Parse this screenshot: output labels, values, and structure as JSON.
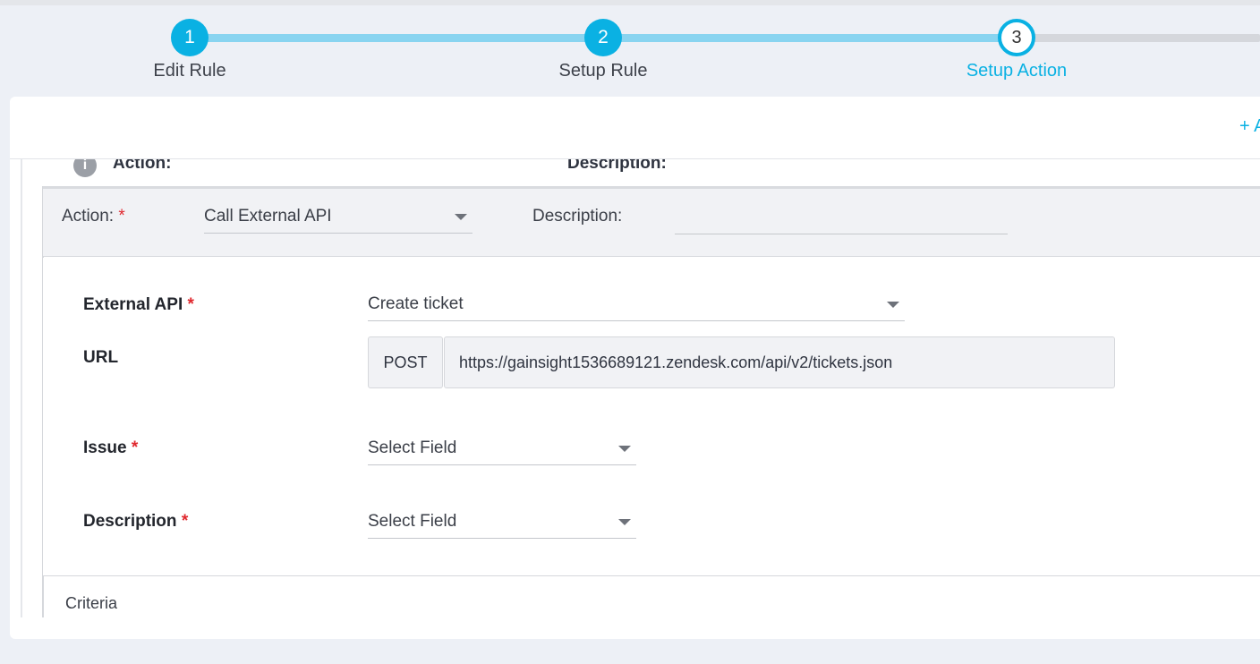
{
  "stepper": {
    "steps": [
      {
        "number": "1",
        "label": "Edit Rule",
        "state": "done"
      },
      {
        "number": "2",
        "label": "Setup Rule",
        "state": "done"
      },
      {
        "number": "3",
        "label": "Setup Action",
        "state": "active"
      }
    ]
  },
  "panel": {
    "add_link": "+ A"
  },
  "collapsed_action": {
    "action_label": "Action:",
    "description_label": "Description:"
  },
  "action_card": {
    "action_label": "Action:",
    "required_mark": "*",
    "action_value": "Call External API",
    "description_label": "Description:",
    "description_value": ""
  },
  "form": {
    "external_api": {
      "label": "External API",
      "required": "*",
      "value": "Create ticket"
    },
    "url": {
      "label": "URL",
      "method": "POST",
      "value": "https://gainsight1536689121.zendesk.com/api/v2/tickets.json"
    },
    "issue": {
      "label": "Issue",
      "required": "*",
      "value": "Select Field"
    },
    "description": {
      "label": "Description",
      "required": "*",
      "value": "Select Field"
    }
  },
  "criteria": {
    "label": "Criteria"
  },
  "colors": {
    "accent": "#0ab1e3",
    "track_done": "#89d4f0",
    "required": "#e0282e"
  }
}
